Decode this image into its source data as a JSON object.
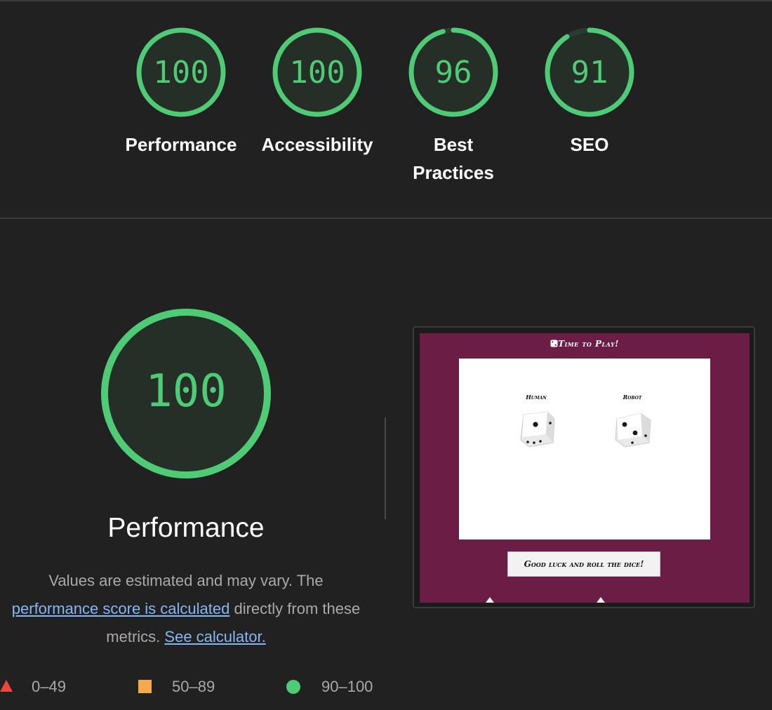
{
  "colors": {
    "background": "#212121",
    "pass": "#4fcb75",
    "average": "#f5a94b",
    "fail": "#f0453c",
    "link": "#86b6f3",
    "screenshot_background": "#6c1d45"
  },
  "gauges": [
    {
      "score": "100",
      "value": 100,
      "label": "Performance"
    },
    {
      "score": "100",
      "value": 100,
      "label": "Accessibility"
    },
    {
      "score": "96",
      "value": 96,
      "label_line1": "Best",
      "label_line2": "Practices"
    },
    {
      "score": "91",
      "value": 91,
      "label": "SEO"
    }
  ],
  "performance": {
    "score": "100",
    "value": 100,
    "title": "Performance",
    "desc_part1": "Values are estimated and may vary. The",
    "link1": "performance score is calculated",
    "desc_part2": "directly from these metrics.",
    "link2": "See calculator."
  },
  "legend": {
    "fail": "0–49",
    "average": "50–89",
    "pass": "90–100"
  },
  "screenshot": {
    "header_icon": "dice-icon",
    "header": "Time to Play!",
    "human_label": "Human",
    "robot_label": "Robot",
    "human_die_value": 1,
    "robot_die_value": 2,
    "button": "Good luck and roll the dice!"
  }
}
